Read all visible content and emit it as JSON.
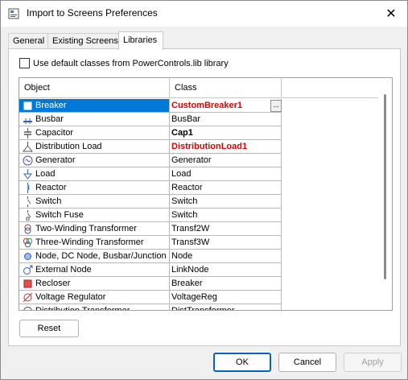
{
  "window": {
    "title": "Import to Screens Preferences",
    "close_glyph": "✕"
  },
  "tabs": [
    {
      "label": "General",
      "active": false
    },
    {
      "label": "Existing Screens",
      "active": false
    },
    {
      "label": "Libraries",
      "active": true
    }
  ],
  "options": {
    "use_default_label": "Use default classes from PowerControls.lib library",
    "use_default_checked": false
  },
  "grid": {
    "columns": {
      "object": "Object",
      "class": "Class"
    },
    "rows": [
      {
        "object": "Breaker",
        "class": "CustomBreaker1",
        "icon": "breaker-icon",
        "style": "custom",
        "selected": true
      },
      {
        "object": "Busbar",
        "class": "BusBar",
        "icon": "busbar-icon",
        "style": "normal"
      },
      {
        "object": "Capacitor",
        "class": "Cap1",
        "icon": "capacitor-icon",
        "style": "bold"
      },
      {
        "object": "Distribution Load",
        "class": "DistributionLoad1",
        "icon": "distribution-load-icon",
        "style": "custom"
      },
      {
        "object": "Generator",
        "class": "Generator",
        "icon": "generator-icon",
        "style": "normal"
      },
      {
        "object": "Load",
        "class": "Load",
        "icon": "load-icon",
        "style": "normal"
      },
      {
        "object": "Reactor",
        "class": "Reactor",
        "icon": "reactor-icon",
        "style": "normal"
      },
      {
        "object": "Switch",
        "class": "Switch",
        "icon": "switch-icon",
        "style": "normal"
      },
      {
        "object": "Switch Fuse",
        "class": "Switch",
        "icon": "switch-fuse-icon",
        "style": "normal"
      },
      {
        "object": "Two-Winding Transformer",
        "class": "Transf2W",
        "icon": "two-winding-transformer-icon",
        "style": "normal"
      },
      {
        "object": "Three-Winding Transformer",
        "class": "Transf3W",
        "icon": "three-winding-transformer-icon",
        "style": "normal"
      },
      {
        "object": "Node, DC Node, Busbar/Junction",
        "class": "Node",
        "icon": "node-icon",
        "style": "normal"
      },
      {
        "object": "External Node",
        "class": "LinkNode",
        "icon": "external-node-icon",
        "style": "normal"
      },
      {
        "object": "Recloser",
        "class": "Breaker",
        "icon": "recloser-icon",
        "style": "normal"
      },
      {
        "object": "Voltage Regulator",
        "class": "VoltageReg",
        "icon": "voltage-regulator-icon",
        "style": "normal"
      },
      {
        "object": "Distribution Transformer",
        "class": "DistTransformer",
        "icon": "distribution-transformer-icon",
        "style": "normal"
      }
    ],
    "ellipsis_label": "..."
  },
  "buttons": {
    "reset": "Reset",
    "ok": "OK",
    "cancel": "Cancel",
    "apply": "Apply"
  },
  "colors": {
    "selection": "#0078d7",
    "custom_class": "#e00000",
    "default_border": "#0067c0"
  }
}
